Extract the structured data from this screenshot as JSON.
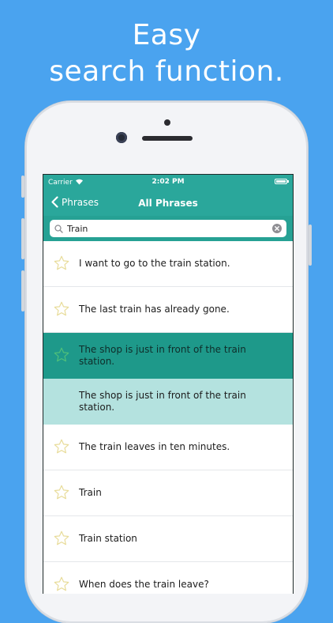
{
  "headline": {
    "line1": "Easy",
    "line2": "search function."
  },
  "status": {
    "carrier": "Carrier",
    "time": "2:02 PM"
  },
  "nav": {
    "back_label": "Phrases",
    "title": "All Phrases"
  },
  "search": {
    "value": "Train"
  },
  "phrases": [
    {
      "text": "I want to go to the train station.",
      "state": "normal",
      "icon": "star-outline-icon"
    },
    {
      "text": "The last train has already gone.",
      "state": "normal",
      "icon": "star-outline-icon"
    },
    {
      "text": "The shop is just in front of the train station.",
      "state": "selected",
      "icon": "star-outline-icon"
    },
    {
      "text": "The shop is just in front of the train station.",
      "state": "detail",
      "icon": ""
    },
    {
      "text": "The train leaves in ten minutes.",
      "state": "normal",
      "icon": "star-outline-icon"
    },
    {
      "text": "Train",
      "state": "normal",
      "icon": "star-outline-icon"
    },
    {
      "text": "Train station",
      "state": "normal",
      "icon": "star-outline-icon"
    },
    {
      "text": "When does the train leave?",
      "state": "normal",
      "icon": "star-outline-icon"
    }
  ],
  "colors": {
    "background": "#4aa3ef",
    "appbar": "#2aa79b",
    "selected_row": "#1e998a",
    "detail_row": "#b4e2df",
    "star": "#e8dc9a"
  }
}
